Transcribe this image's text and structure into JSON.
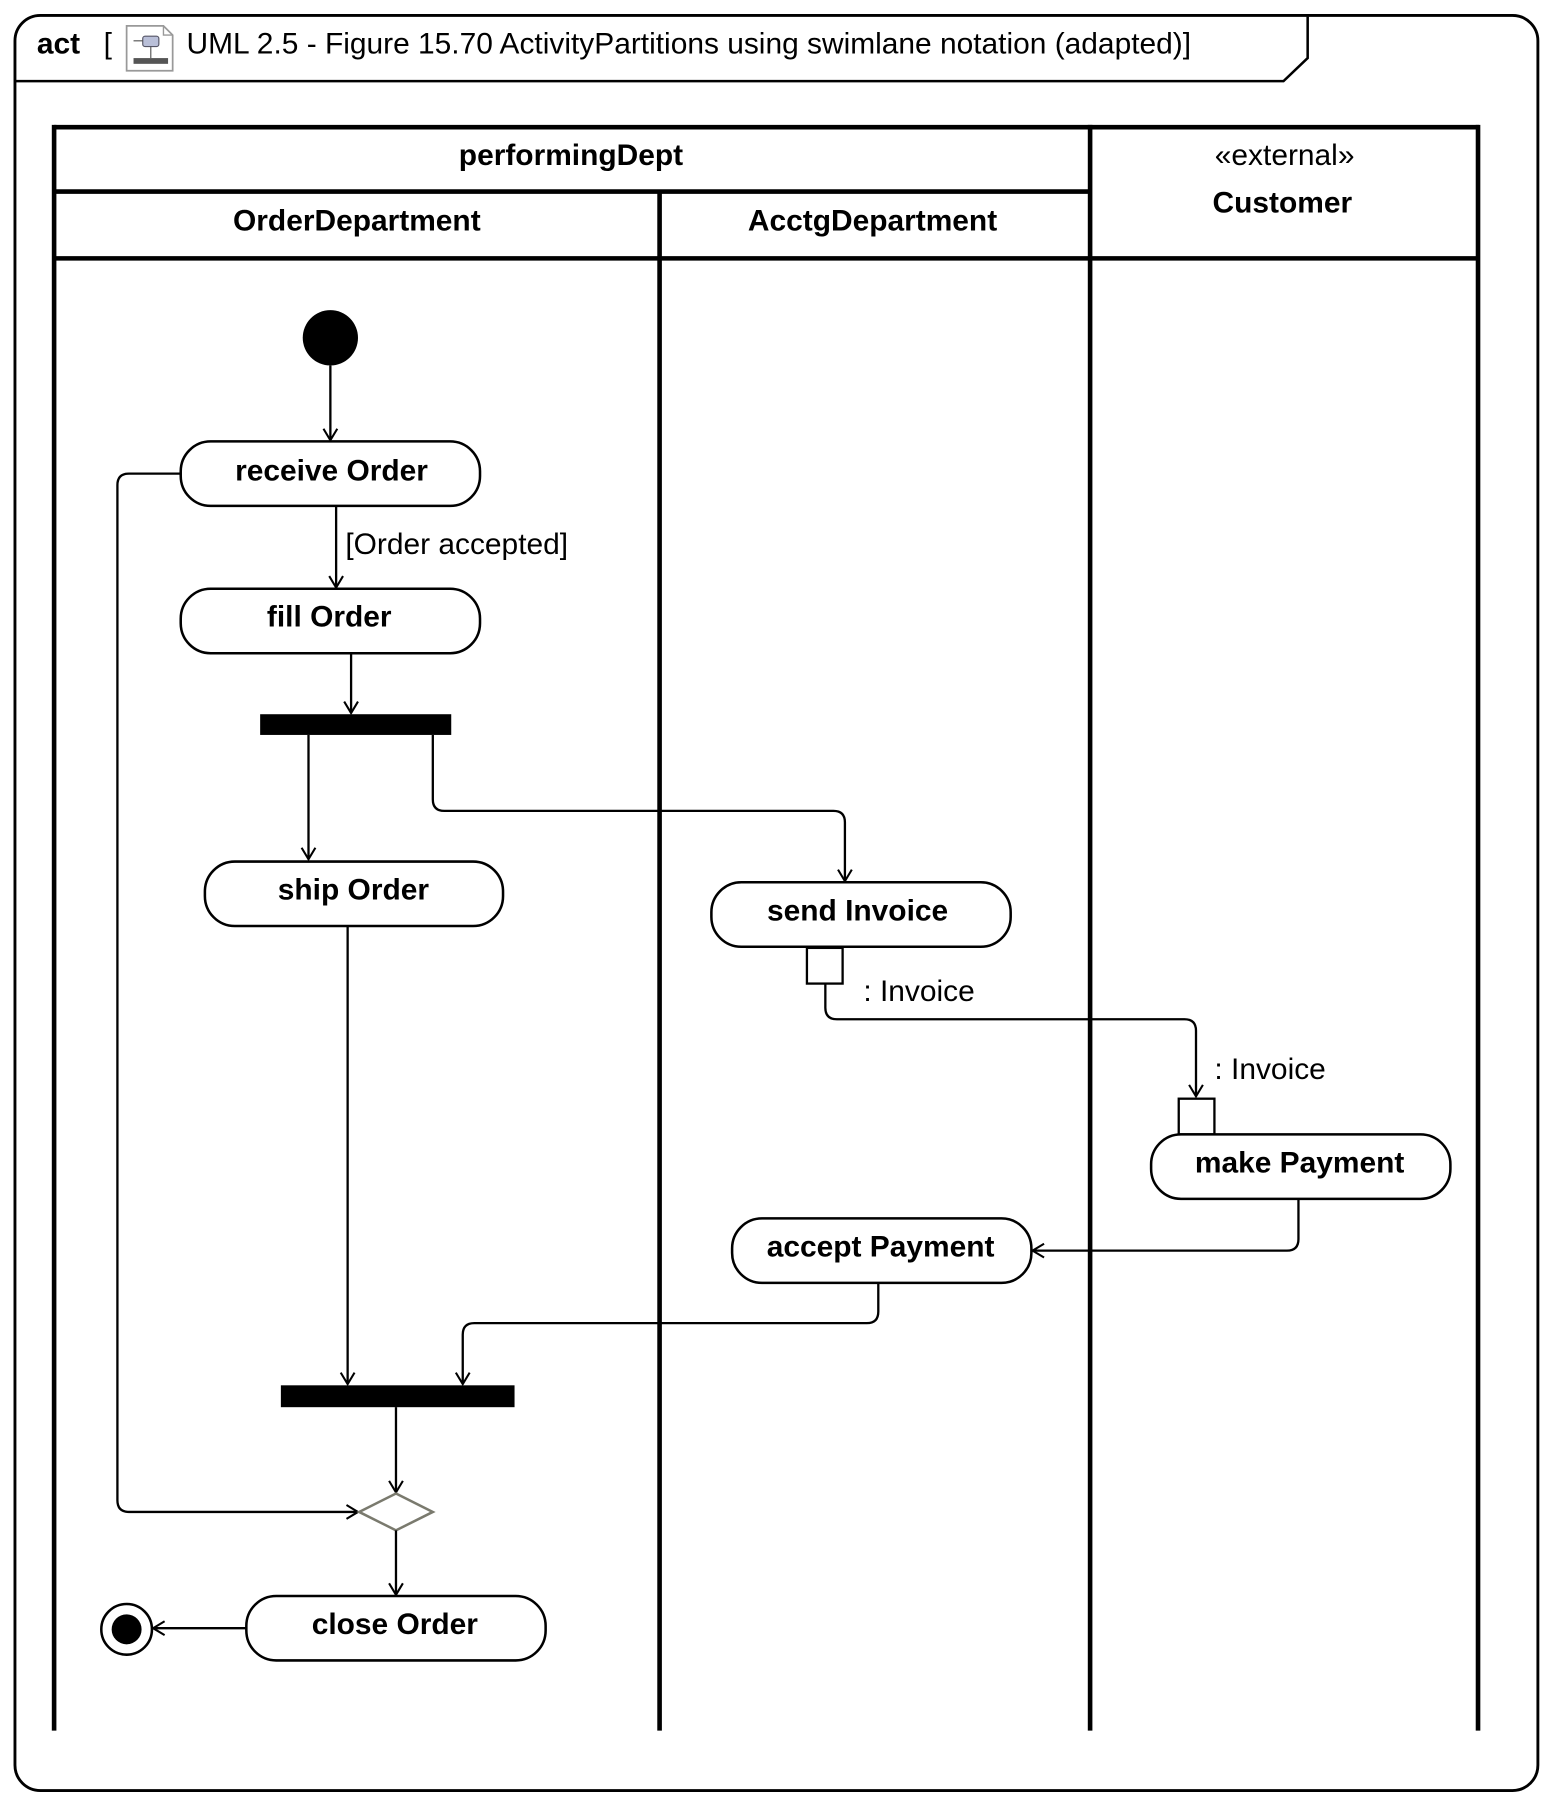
{
  "frame": {
    "kind": "act",
    "open_bracket": "[",
    "title": "UML 2.5 - Figure 15.70 ActivityPartitions using swimlane notation (adapted)]",
    "icon": "activity-diagram-icon"
  },
  "partitions": {
    "parent": "performingDept",
    "order_dept": "OrderDepartment",
    "acctg_dept": "AcctgDepartment",
    "customer_stereotype": "«external»",
    "customer": "Customer"
  },
  "actions": {
    "receive_order": "receive Order",
    "fill_order": "fill Order",
    "ship_order": "ship Order",
    "send_invoice": "send Invoice",
    "make_payment": "make Payment",
    "accept_payment": "accept Payment",
    "close_order": "close Order"
  },
  "labels": {
    "guard_order_accepted": "[Order accepted]",
    "output_pin": ": Invoice",
    "input_pin": ": Invoice"
  },
  "colors": {
    "line": "#000000",
    "merge_node": "#7a7a6e",
    "background": "#ffffff"
  }
}
